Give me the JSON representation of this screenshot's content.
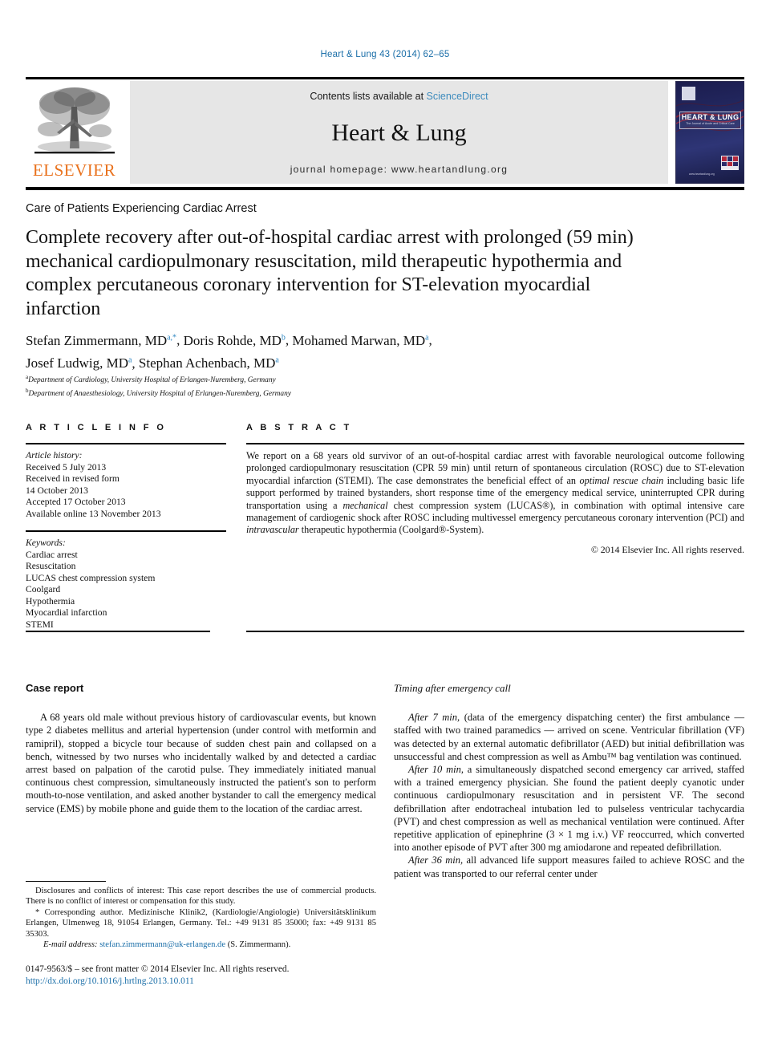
{
  "running_head": "Heart & Lung 43 (2014) 62–65",
  "masthead": {
    "publisher_name": "ELSEVIER",
    "contents_prefix": "Contents lists available at ",
    "contents_link": "ScienceDirect",
    "journal_title": "Heart & Lung",
    "homepage": "journal homepage: www.heartandlung.org",
    "cover": {
      "title": "HEART & LUNG",
      "subtitle": "The Journal of Acute and Critical Care",
      "url": "www.heartandlung.org"
    }
  },
  "article": {
    "section_kicker": "Care of Patients Experiencing Cardiac Arrest",
    "title": "Complete recovery after out-of-hospital cardiac arrest with prolonged (59 min) mechanical cardiopulmonary resuscitation, mild therapeutic hypothermia and complex percutaneous coronary intervention for ST-elevation myocardial infarction",
    "authors": [
      {
        "name": "Stefan Zimmermann, MD",
        "marks": "a,*"
      },
      {
        "name": "Doris Rohde, MD",
        "marks": "b"
      },
      {
        "name": "Mohamed Marwan, MD",
        "marks": "a"
      },
      {
        "name": "Josef Ludwig, MD",
        "marks": "a"
      },
      {
        "name": "Stephan Achenbach, MD",
        "marks": "a"
      }
    ],
    "affiliations": [
      {
        "mark": "a",
        "text": "Department of Cardiology, University Hospital of Erlangen-Nuremberg, Germany"
      },
      {
        "mark": "b",
        "text": "Department of Anaesthesiology, University Hospital of Erlangen-Nuremberg, Germany"
      }
    ]
  },
  "article_info": {
    "heading": "A R T I C L E  I N F O",
    "history_label": "Article history:",
    "history": [
      "Received 5 July 2013",
      "Received in revised form",
      "14 October 2013",
      "Accepted 17 October 2013",
      "Available online 13 November 2013"
    ],
    "keywords_label": "Keywords:",
    "keywords": [
      "Cardiac arrest",
      "Resuscitation",
      "LUCAS chest compression system",
      "Coolgard",
      "Hypothermia",
      "Myocardial infarction",
      "STEMI"
    ]
  },
  "abstract": {
    "heading": "A B S T R A C T",
    "part1": "We report on a 68 years old survivor of an out-of-hospital cardiac arrest with favorable neurological outcome following prolonged cardiopulmonary resuscitation (CPR 59 min) until return of spontaneous circulation (ROSC) due to ST-elevation myocardial infarction (STEMI). The case demonstrates the beneficial effect of an ",
    "italic1": "optimal rescue chain",
    "part2": " including basic life support performed by trained bystanders, short response time of the emergency medical service, uninterrupted CPR during transportation using a ",
    "italic2": "mechanical",
    "part3": " chest compression system (LUCAS®), in combination with optimal intensive care management of cardiogenic shock after ROSC including multivessel emergency percutaneous coronary intervention (PCI) and ",
    "italic3": "intravascular",
    "part4": " therapeutic hypothermia (Coolgard®-System).",
    "copyright": "© 2014 Elsevier Inc. All rights reserved."
  },
  "body": {
    "left_heading": "Case report",
    "left_paragraph": "A 68 years old male without previous history of cardiovascular events, but known type 2 diabetes mellitus and arterial hypertension (under control with metformin and ramipril), stopped a bicycle tour because of sudden chest pain and collapsed on a bench, witnessed by two nurses who incidentally walked by and detected a cardiac arrest based on palpation of the carotid pulse. They immediately initiated manual continuous chest compression, simultaneously instructed the patient's son to perform mouth-to-nose ventilation, and asked another bystander to call the emergency medical service (EMS) by mobile phone and guide them to the location of the cardiac arrest.",
    "right_heading": "Timing after emergency call",
    "right_paragraphs": [
      {
        "lead": "After 7 min,",
        "text": " (data of the emergency dispatching center) the first ambulance — staffed with two trained paramedics — arrived on scene. Ventricular fibrillation (VF) was detected by an external automatic defibrillator (AED) but initial defibrillation was unsuccessful and chest compression as well as Ambu™ bag ventilation was continued."
      },
      {
        "lead": "After 10 min,",
        "text": " a simultaneously dispatched second emergency car arrived, staffed with a trained emergency physician. She found the patient deeply cyanotic under continuous cardiopulmonary resuscitation and in persistent VF. The second defibrillation after endotracheal intubation led to pulseless ventricular tachycardia (PVT) and chest compression as well as mechanical ventilation were continued. After repetitive application of epinephrine (3 × 1 mg i.v.) VF reoccurred, which converted into another episode of PVT after 300 mg amiodarone and repeated defibrillation."
      },
      {
        "lead": "After 36 min,",
        "text": " all advanced life support measures failed to achieve ROSC and the patient was transported to our referral center under"
      }
    ]
  },
  "footnotes": {
    "disclosures": "Disclosures and conflicts of interest: This case report describes the use of commercial products. There is no conflict of interest or compensation for this study.",
    "corresponding": "* Corresponding author. Medizinische Klinik2, (Kardiologie/Angiologie) Universitätsklinikum Erlangen, Ulmenweg 18, 91054 Erlangen, Germany. Tel.: +49 9131 85 35000; fax: +49 9131 85 35303.",
    "email_label": "E-mail address:",
    "email": "stefan.zimmermann@uk-erlangen.de",
    "email_suffix": " (S. Zimmermann)."
  },
  "imprint": {
    "line1": "0147-9563/$ – see front matter © 2014 Elsevier Inc. All rights reserved.",
    "doi": "http://dx.doi.org/10.1016/j.hrtlng.2013.10.011"
  }
}
